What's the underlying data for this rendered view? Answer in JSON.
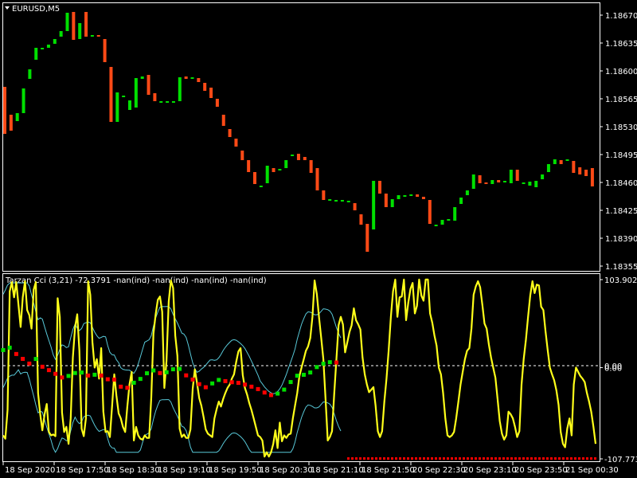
{
  "window": {
    "symbol_title": "EURUSD,M5",
    "menu_icon": "triangle-down-icon"
  },
  "colors": {
    "background": "#000000",
    "frame": "#ffffff",
    "bull": "#00e000",
    "bear": "#ff4a16",
    "cci_line": "#ffff1a",
    "bands": "#58c8d8",
    "zero_line": "#ffffff",
    "dot_up": "#00e000",
    "dot_down": "#ff0000",
    "text": "#ffffff"
  },
  "chart_data": [
    {
      "type": "candlestick",
      "title": "EURUSD,M5",
      "yticks": [
        "1.18670",
        "1.18635",
        "1.18600",
        "1.18565",
        "1.18530",
        "1.18495",
        "1.18460",
        "1.18425",
        "1.18390",
        "1.18355"
      ],
      "ylim": [
        1.18349,
        1.18685
      ],
      "grid": false,
      "candles": [
        {
          "o": 1.1858,
          "c": 1.18521
        },
        {
          "o": 1.18545,
          "c": 1.18525
        },
        {
          "o": 1.18537,
          "c": 1.18547
        },
        {
          "o": 1.18547,
          "c": 1.18578
        },
        {
          "o": 1.1859,
          "c": 1.18602
        },
        {
          "o": 1.18614,
          "c": 1.18629
        },
        {
          "o": 1.18629,
          "c": 1.18629
        },
        {
          "o": 1.18629,
          "c": 1.18633
        },
        {
          "o": 1.18634,
          "c": 1.1864
        },
        {
          "o": 1.18643,
          "c": 1.1865
        },
        {
          "o": 1.1865,
          "c": 1.18673
        },
        {
          "o": 1.18674,
          "c": 1.18639
        },
        {
          "o": 1.1864,
          "c": 1.1866
        },
        {
          "o": 1.18674,
          "c": 1.18643
        },
        {
          "o": 1.18645,
          "c": 1.18645
        },
        {
          "o": 1.18645,
          "c": 1.18643
        },
        {
          "o": 1.1864,
          "c": 1.18611
        },
        {
          "o": 1.18605,
          "c": 1.18536
        },
        {
          "o": 1.18536,
          "c": 1.18573
        },
        {
          "o": 1.18568,
          "c": 1.18569
        },
        {
          "o": 1.18551,
          "c": 1.18563
        },
        {
          "o": 1.18554,
          "c": 1.18591
        },
        {
          "o": 1.1859,
          "c": 1.18593
        },
        {
          "o": 1.18595,
          "c": 1.1857
        },
        {
          "o": 1.18572,
          "c": 1.18562
        },
        {
          "o": 1.18562,
          "c": 1.18562
        },
        {
          "o": 1.18562,
          "c": 1.18562
        },
        {
          "o": 1.18562,
          "c": 1.18562
        },
        {
          "o": 1.18562,
          "c": 1.18592
        },
        {
          "o": 1.18593,
          "c": 1.1859
        },
        {
          "o": 1.1859,
          "c": 1.18592
        },
        {
          "o": 1.18591,
          "c": 1.18586
        },
        {
          "o": 1.18585,
          "c": 1.18575
        },
        {
          "o": 1.18579,
          "c": 1.18566
        },
        {
          "o": 1.18565,
          "c": 1.18555
        },
        {
          "o": 1.18545,
          "c": 1.18531
        },
        {
          "o": 1.18527,
          "c": 1.18517
        },
        {
          "o": 1.18515,
          "c": 1.18505
        },
        {
          "o": 1.185,
          "c": 1.18488
        },
        {
          "o": 1.18488,
          "c": 1.18473
        },
        {
          "o": 1.18473,
          "c": 1.18458
        },
        {
          "o": 1.18456,
          "c": 1.18456
        },
        {
          "o": 1.18459,
          "c": 1.18481
        },
        {
          "o": 1.18478,
          "c": 1.18473
        },
        {
          "o": 1.18476,
          "c": 1.18477
        },
        {
          "o": 1.18478,
          "c": 1.18488
        },
        {
          "o": 1.18493,
          "c": 1.18495
        },
        {
          "o": 1.18496,
          "c": 1.18488
        },
        {
          "o": 1.18492,
          "c": 1.18488
        },
        {
          "o": 1.18488,
          "c": 1.18472
        },
        {
          "o": 1.18478,
          "c": 1.1845
        },
        {
          "o": 1.1845,
          "c": 1.18438
        },
        {
          "o": 1.18438,
          "c": 1.18439
        },
        {
          "o": 1.18438,
          "c": 1.18438
        },
        {
          "o": 1.18438,
          "c": 1.18438
        },
        {
          "o": 1.18437,
          "c": 1.18437
        },
        {
          "o": 1.18434,
          "c": 1.18425
        },
        {
          "o": 1.1842,
          "c": 1.18407
        },
        {
          "o": 1.18408,
          "c": 1.18373
        },
        {
          "o": 1.18401,
          "c": 1.18462
        },
        {
          "o": 1.18462,
          "c": 1.18446
        },
        {
          "o": 1.18446,
          "c": 1.18429
        },
        {
          "o": 1.18429,
          "c": 1.18439
        },
        {
          "o": 1.18439,
          "c": 1.18444
        },
        {
          "o": 1.18444,
          "c": 1.18444
        },
        {
          "o": 1.18445,
          "c": 1.18445
        },
        {
          "o": 1.18445,
          "c": 1.18442
        },
        {
          "o": 1.18442,
          "c": 1.18439
        },
        {
          "o": 1.18438,
          "c": 1.18408
        },
        {
          "o": 1.18406,
          "c": 1.18407
        },
        {
          "o": 1.18407,
          "c": 1.18413
        },
        {
          "o": 1.18412,
          "c": 1.18414
        },
        {
          "o": 1.18412,
          "c": 1.18429
        },
        {
          "o": 1.18433,
          "c": 1.18441
        },
        {
          "o": 1.18444,
          "c": 1.1845
        },
        {
          "o": 1.18452,
          "c": 1.1847
        },
        {
          "o": 1.18469,
          "c": 1.18459
        },
        {
          "o": 1.1846,
          "c": 1.18458
        },
        {
          "o": 1.18458,
          "c": 1.18463
        },
        {
          "o": 1.18463,
          "c": 1.1846
        },
        {
          "o": 1.1846,
          "c": 1.18462
        },
        {
          "o": 1.18459,
          "c": 1.18476
        },
        {
          "o": 1.18476,
          "c": 1.18462
        },
        {
          "o": 1.1846,
          "c": 1.1846
        },
        {
          "o": 1.18456,
          "c": 1.18461
        },
        {
          "o": 1.18454,
          "c": 1.18462
        },
        {
          "o": 1.18464,
          "c": 1.1847
        },
        {
          "o": 1.18473,
          "c": 1.18483
        },
        {
          "o": 1.18483,
          "c": 1.18489
        },
        {
          "o": 1.18488,
          "c": 1.18483
        },
        {
          "o": 1.18489,
          "c": 1.18489
        },
        {
          "o": 1.18487,
          "c": 1.18472
        },
        {
          "o": 1.18479,
          "c": 1.1847
        },
        {
          "o": 1.18476,
          "c": 1.18468
        },
        {
          "o": 1.18478,
          "c": 1.18455
        }
      ],
      "series_colors": {
        "bull": "#00e000",
        "bear": "#ff4a16"
      }
    },
    {
      "type": "line",
      "title": "Tarzan Cci (3,21) -72.3791 -nan(ind) -nan(ind) -nan(ind) -nan(ind)",
      "yticks": [
        "103.9026",
        "0.00",
        "-107.7738"
      ],
      "ylim": [
        -107.7738,
        103.9026
      ],
      "grid": false,
      "series": [
        {
          "values": [
            -80,
            -84,
            -50,
            90,
            101,
            83,
            101,
            75,
            48,
            83,
            102,
            68,
            62,
            46,
            92,
            101,
            -30,
            -55,
            -74,
            -55,
            -43,
            -76,
            -80,
            -79,
            -81,
            82,
            60,
            -53,
            -76,
            -70,
            -90,
            -60,
            12,
            48,
            63,
            20,
            -72,
            -81,
            -60,
            102,
            86,
            30,
            0,
            10,
            -13,
            23,
            -52,
            -76,
            -75,
            -82,
            -45,
            -8,
            -33,
            -54,
            -60,
            -70,
            -76,
            -46,
            -20,
            -5,
            -86,
            -70,
            -80,
            -84,
            -85,
            -80,
            -83,
            -83,
            -35,
            40,
            63,
            80,
            84,
            66,
            -24,
            8,
            78,
            103,
            94,
            38,
            14,
            -72,
            -82,
            -79,
            -83,
            -83,
            -73,
            -25,
            -2,
            -18,
            -36,
            -45,
            -58,
            -73,
            -78,
            -80,
            -82,
            -60,
            -49,
            -40,
            -46,
            -37,
            -30,
            -24,
            -20,
            -13,
            -8,
            7,
            19,
            23,
            -9,
            -24,
            -32,
            -42,
            -50,
            -60,
            -70,
            -80,
            -82,
            -86,
            -105,
            -100,
            -105,
            -100,
            -90,
            -74,
            -95,
            -65,
            -87,
            -80,
            -83,
            -79,
            -78,
            -60,
            -45,
            -30,
            -10,
            0,
            10,
            20,
            25,
            35,
            60,
            103,
            87,
            60,
            35,
            10,
            -36,
            -86,
            -82,
            -75,
            -30,
            10,
            50,
            60,
            51,
            18,
            30,
            42,
            50,
            70,
            56,
            51,
            45,
            12,
            -8,
            -20,
            -29,
            -26,
            -23,
            -45,
            -75,
            -82,
            -75,
            -40,
            -13,
            20,
            60,
            90,
            104,
            60,
            83,
            84,
            104,
            56,
            77,
            93,
            100,
            64,
            73,
            104,
            85,
            79,
            104,
            104,
            64,
            53,
            38,
            26,
            0,
            -8,
            -30,
            -60,
            -80,
            -82,
            -80,
            -76,
            -60,
            -40,
            -20,
            -5,
            10,
            20,
            23,
            46,
            86,
            96,
            102,
            95,
            74,
            52,
            46,
            27,
            12,
            0,
            -12,
            -37,
            -63,
            -78,
            -85,
            -80,
            -52,
            -55,
            -60,
            -70,
            -82,
            -75,
            -20,
            10,
            33,
            60,
            85,
            102,
            88,
            98,
            97,
            72,
            68,
            43,
            21,
            0,
            -8,
            -15,
            -27,
            -44,
            -76,
            -90,
            -94,
            -72,
            -60,
            -80,
            -20,
            0,
            -5,
            -10,
            -13,
            -17,
            -30,
            -40,
            -52,
            -70,
            -90
          ]
        }
      ],
      "series_colors": {
        "cci": "#ffff1a",
        "bands": "#58c8d8"
      }
    }
  ],
  "time_axis": [
    "18 Sep 2020",
    "18 Sep 17:50",
    "18 Sep 18:30",
    "18 Sep 19:10",
    "18 Sep 19:50",
    "18 Sep 20:30",
    "18 Sep 21:10",
    "18 Sep 21:50",
    "20 Sep 22:30",
    "20 Sep 23:10",
    "20 Sep 23:50",
    "21 Sep 00:30"
  ],
  "price_right_label": "0.00"
}
